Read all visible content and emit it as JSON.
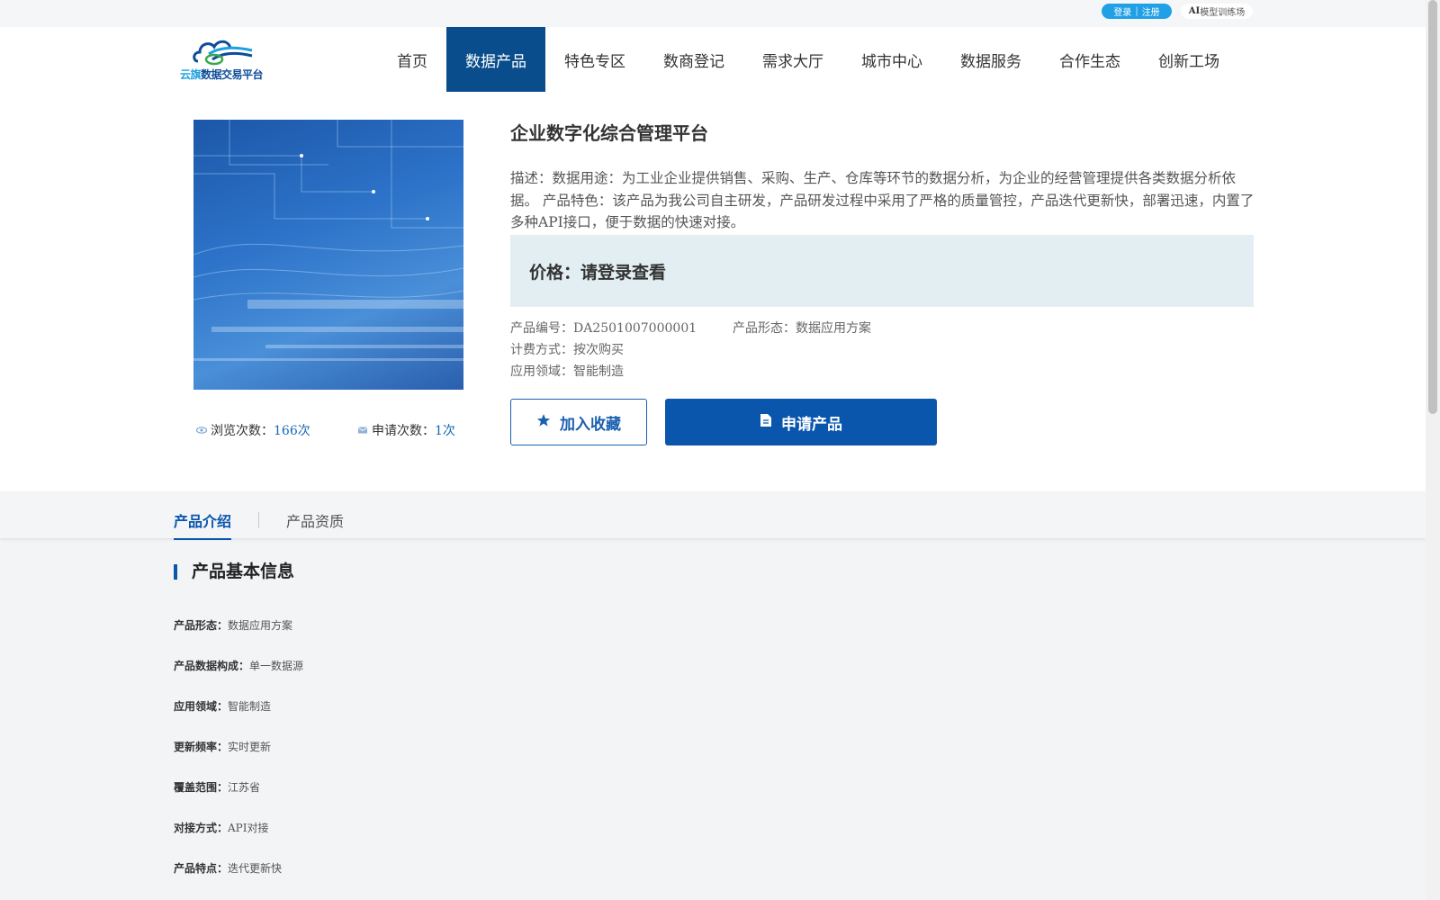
{
  "topbar": {
    "login": "登录",
    "separator": "|",
    "register": "注册",
    "ai_bold": "AI",
    "ai_rest": "模型训练场"
  },
  "brand": {
    "name_highlight": "云旗",
    "name_rest": "数据交易平台",
    "colors": {
      "primary": "#0a4d8c",
      "accent": "#1ea0e0"
    }
  },
  "nav": {
    "items": [
      {
        "label": "首页",
        "active": false
      },
      {
        "label": "数据产品",
        "active": true
      },
      {
        "label": "特色专区",
        "active": false
      },
      {
        "label": "数商登记",
        "active": false
      },
      {
        "label": "需求大厅",
        "active": false
      },
      {
        "label": "城市中心",
        "active": false
      },
      {
        "label": "数据服务",
        "active": false
      },
      {
        "label": "合作生态",
        "active": false
      },
      {
        "label": "创新工场",
        "active": false
      }
    ]
  },
  "product": {
    "title": "企业数字化综合管理平台",
    "description": "描述：数据用途：为工业企业提供销售、采购、生产、仓库等环节的数据分析，为企业的经营管理提供各类数据分析依据。 产品特色：该产品为我公司自主研发，产品研发过程中采用了严格的质量管控，产品迭代更新快，部署迅速，内置了多种API接口，便于数据的快速对接。",
    "price": "价格：请登录查看",
    "code_label": "产品编号：",
    "code": "DA2501007000001",
    "form_label": "产品形态：",
    "form": "数据应用方案",
    "billing_label": "计费方式：",
    "billing": "按次购买",
    "domain_label": "应用领域：",
    "domain": "智能制造",
    "views_label": "浏览次数：",
    "views": "166次",
    "applies_label": "申请次数：",
    "applies": "1次",
    "favorite_button": "加入收藏",
    "apply_button": "申请产品",
    "icons": {
      "views": "eye-icon",
      "applies": "mail-icon",
      "favorite": "star-icon",
      "apply": "document-icon"
    }
  },
  "tabs": [
    {
      "label": "产品介绍",
      "active": true
    },
    {
      "label": "产品资质",
      "active": false
    }
  ],
  "basic_info": {
    "title": "产品基本信息",
    "rows": [
      {
        "key": "产品形态：",
        "value": "数据应用方案"
      },
      {
        "key": "产品数据构成：",
        "value": "单一数据源"
      },
      {
        "key": "应用领域：",
        "value": "智能制造"
      },
      {
        "key": "更新频率：",
        "value": "实时更新"
      },
      {
        "key": "覆盖范围：",
        "value": "江苏省"
      },
      {
        "key": "对接方式：",
        "value": "API对接"
      },
      {
        "key": "产品特点：",
        "value": "迭代更新快"
      }
    ]
  }
}
